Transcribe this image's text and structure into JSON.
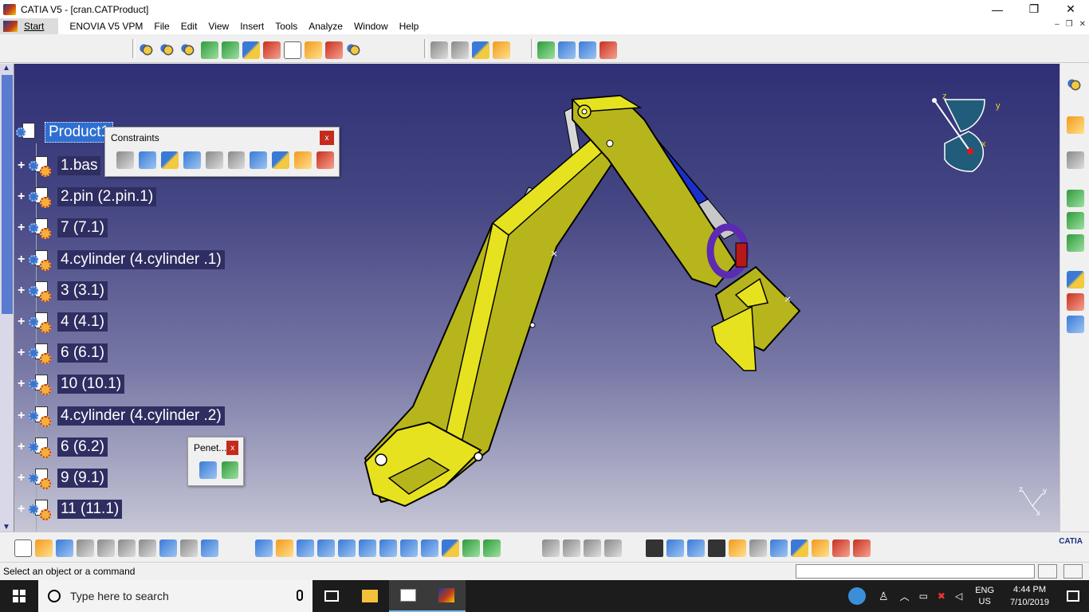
{
  "window": {
    "title": "CATIA V5 - [cran.CATProduct]",
    "minimize": "—",
    "maximize": "❐",
    "close": "✕"
  },
  "menu": {
    "start": "Start",
    "items": [
      "ENOVIA V5 VPM",
      "File",
      "Edit",
      "View",
      "Insert",
      "Tools",
      "Analyze",
      "Window",
      "Help"
    ],
    "mdi_minimize": "–",
    "mdi_restore": "❐",
    "mdi_close": "✕"
  },
  "tree": {
    "root": "Product1",
    "nodes": [
      "1.bas",
      "2.pin (2.pin.1)",
      "7 (7.1)",
      "4.cylinder  (4.cylinder .1)",
      "3 (3.1)",
      "4 (4.1)",
      "6 (6.1)",
      "10 (10.1)",
      "4.cylinder  (4.cylinder .2)",
      "6 (6.2)",
      "9 (9.1)",
      "11 (11.1)"
    ]
  },
  "constraints_toolbar": {
    "title": "Constraints",
    "close": "x",
    "icons": [
      "coincidence-icon",
      "contact-icon",
      "offset-icon",
      "angle-icon",
      "fix-icon",
      "fix-together-icon",
      "quick-constraint-icon",
      "flexible-rigid-icon",
      "change-constraint-icon",
      "reuse-pattern-icon"
    ]
  },
  "penetration_toolbar": {
    "title": "Penet...",
    "close": "x"
  },
  "compass": {
    "x": "x",
    "y": "y",
    "z": "z"
  },
  "axis": {
    "x": "x",
    "y": "y",
    "z": "z"
  },
  "status": {
    "message": "Select an object or a command"
  },
  "brand": {
    "catia": "CATIA"
  },
  "taskbar": {
    "search_placeholder": "Type here to search",
    "lang_top": "ENG",
    "lang_bottom": "US",
    "time": "4:44 PM",
    "date": "7/10/2019"
  },
  "colors": {
    "viewport_top": "#2f3075",
    "viewport_bottom": "#c6c6d6",
    "selection": "#2f6fd1",
    "model_yellow": "#d6d31c",
    "model_blue": "#1b2fc9"
  }
}
